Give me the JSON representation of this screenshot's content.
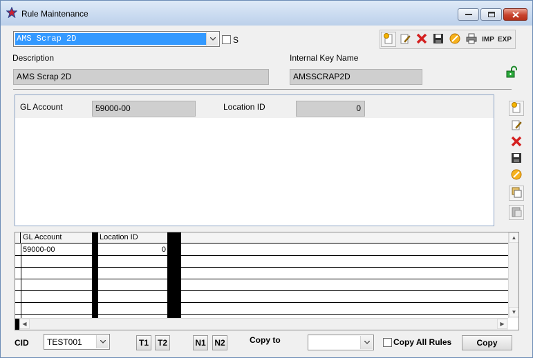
{
  "window": {
    "title": "Rule Maintenance"
  },
  "header": {
    "rule_select": {
      "selected": "AMS Scrap 2D"
    },
    "s_checkbox_label": "S",
    "toolbar": {
      "imp_label": "IMP",
      "exp_label": "EXP"
    }
  },
  "fields": {
    "description_label": "Description",
    "description_value": "AMS Scrap 2D",
    "internal_key_label": "Internal Key Name",
    "internal_key_value": "AMSSCRAP2D"
  },
  "detail": {
    "gl_account_label": "GL Account",
    "gl_account_value": "59000-00",
    "location_id_label": "Location ID",
    "location_id_value": "0"
  },
  "grid": {
    "columns": [
      "GL Account",
      "Location ID"
    ],
    "rows": [
      {
        "gl_account": "59000-00",
        "location_id": "0"
      }
    ]
  },
  "footer": {
    "cid_label": "CID",
    "cid_value": "TEST001",
    "t1": "T1",
    "t2": "T2",
    "n1": "N1",
    "n2": "N2",
    "copy_to_label": "Copy to",
    "copy_to_value": "",
    "copy_all_rules_label": "Copy All Rules",
    "copy_button": "Copy"
  },
  "colors": {
    "selection": "#3399ff",
    "readonly_field": "#cfcfcf",
    "close_button": "#c8432e"
  }
}
